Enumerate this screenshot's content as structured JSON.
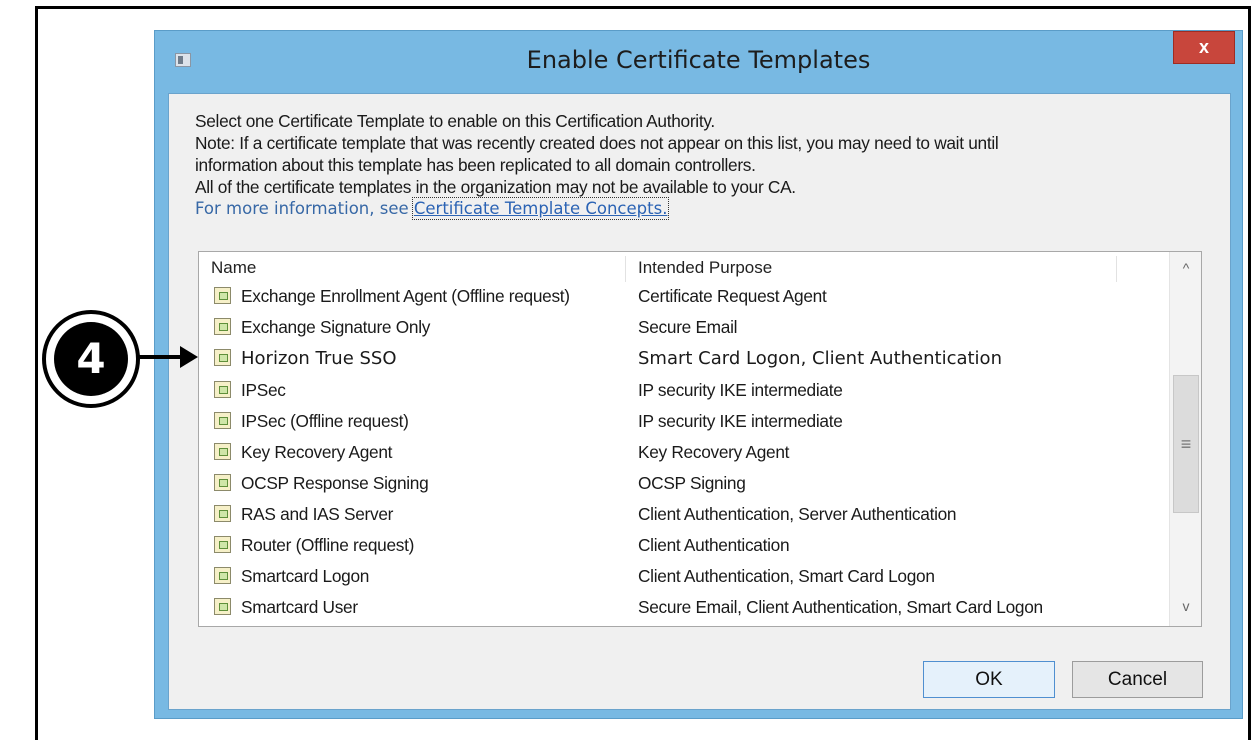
{
  "dialog": {
    "title": "Enable Certificate Templates",
    "close_label": "x",
    "info_lines": [
      "Select one Certificate Template to enable on this Certification Authority.",
      "Note: If a certificate template that was recently created does not appear on this list, you may need to wait until",
      "information about this template has been replicated to all domain controllers.",
      "All of the certificate templates in the organization may not be available to your CA."
    ],
    "more_info_prefix": "For more information, see ",
    "more_info_link": "Certificate Template Concepts."
  },
  "list": {
    "columns": [
      "Name",
      "Intended Purpose"
    ],
    "rows": [
      {
        "name": "Exchange Enrollment Agent (Offline request)",
        "purpose": "Certificate Request Agent"
      },
      {
        "name": "Exchange Signature Only",
        "purpose": "Secure Email"
      },
      {
        "name": "Horizon True SSO",
        "purpose": "Smart Card Logon, Client Authentication"
      },
      {
        "name": "IPSec",
        "purpose": "IP security IKE intermediate"
      },
      {
        "name": "IPSec (Offline request)",
        "purpose": "IP security IKE intermediate"
      },
      {
        "name": "Key Recovery Agent",
        "purpose": "Key Recovery Agent"
      },
      {
        "name": "OCSP Response Signing",
        "purpose": "OCSP Signing"
      },
      {
        "name": "RAS and IAS Server",
        "purpose": "Client Authentication, Server Authentication"
      },
      {
        "name": "Router (Offline request)",
        "purpose": "Client Authentication"
      },
      {
        "name": "Smartcard Logon",
        "purpose": "Client Authentication, Smart Card Logon"
      },
      {
        "name": "Smartcard User",
        "purpose": "Secure Email, Client Authentication, Smart Card Logon"
      }
    ],
    "scroll_up_glyph": "^",
    "scroll_down_glyph": "v",
    "scroll_grip_glyph": "≡"
  },
  "buttons": {
    "ok": "OK",
    "cancel": "Cancel"
  },
  "callout": {
    "number": "4"
  },
  "colors": {
    "accent": "#78b9e3",
    "close": "#c8463c",
    "link": "#2b63b4"
  }
}
